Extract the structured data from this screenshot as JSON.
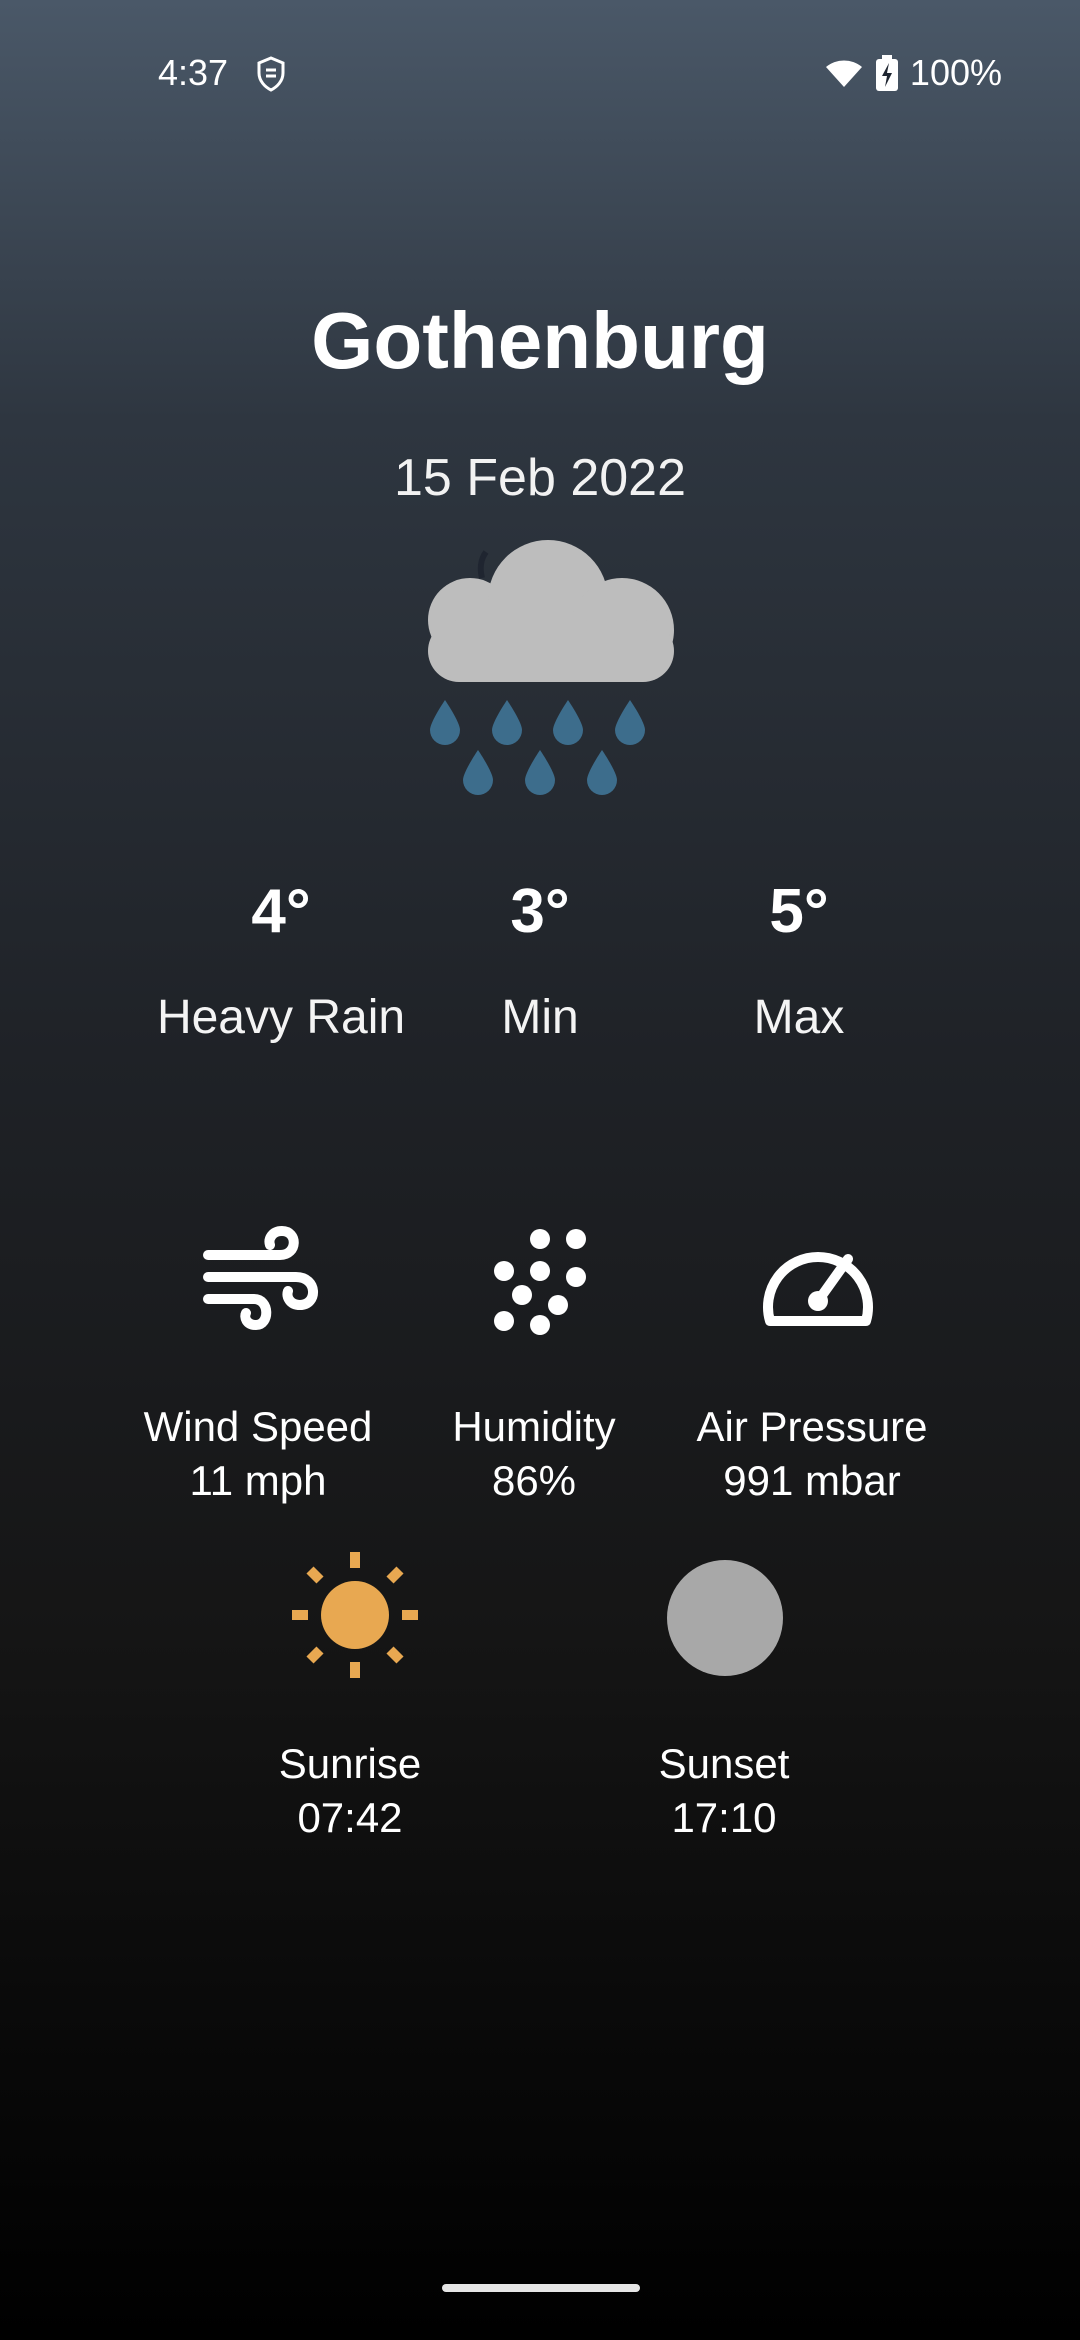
{
  "status_bar": {
    "time": "4:37",
    "battery": "100%",
    "icons": [
      "shield-icon",
      "wifi-icon",
      "battery-charging-icon"
    ]
  },
  "location": {
    "city": "Gothenburg",
    "date": "15 Feb 2022"
  },
  "current": {
    "icon": "heavy-rain-icon",
    "temperature": "4°",
    "condition": "Heavy Rain",
    "min_temp": "3°",
    "min_label": "Min",
    "max_temp": "5°",
    "max_label": "Max"
  },
  "metrics": {
    "wind": {
      "icon": "wind-icon",
      "label": "Wind Speed",
      "value": "11 mph"
    },
    "humidity": {
      "icon": "humidity-icon",
      "label": "Humidity",
      "value": "86%"
    },
    "pressure": {
      "icon": "gauge-icon",
      "label": "Air Pressure",
      "value": "991 mbar"
    }
  },
  "sun": {
    "sunrise": {
      "icon": "sun-icon",
      "label": "Sunrise",
      "value": "07:42"
    },
    "sunset": {
      "icon": "moon-icon",
      "label": "Sunset",
      "value": "17:10"
    }
  },
  "colors": {
    "sun": "#e8a851",
    "rain_drop": "#3d6d8c",
    "cloud": "#bdbdbd",
    "moon": "#a8a8a8"
  }
}
